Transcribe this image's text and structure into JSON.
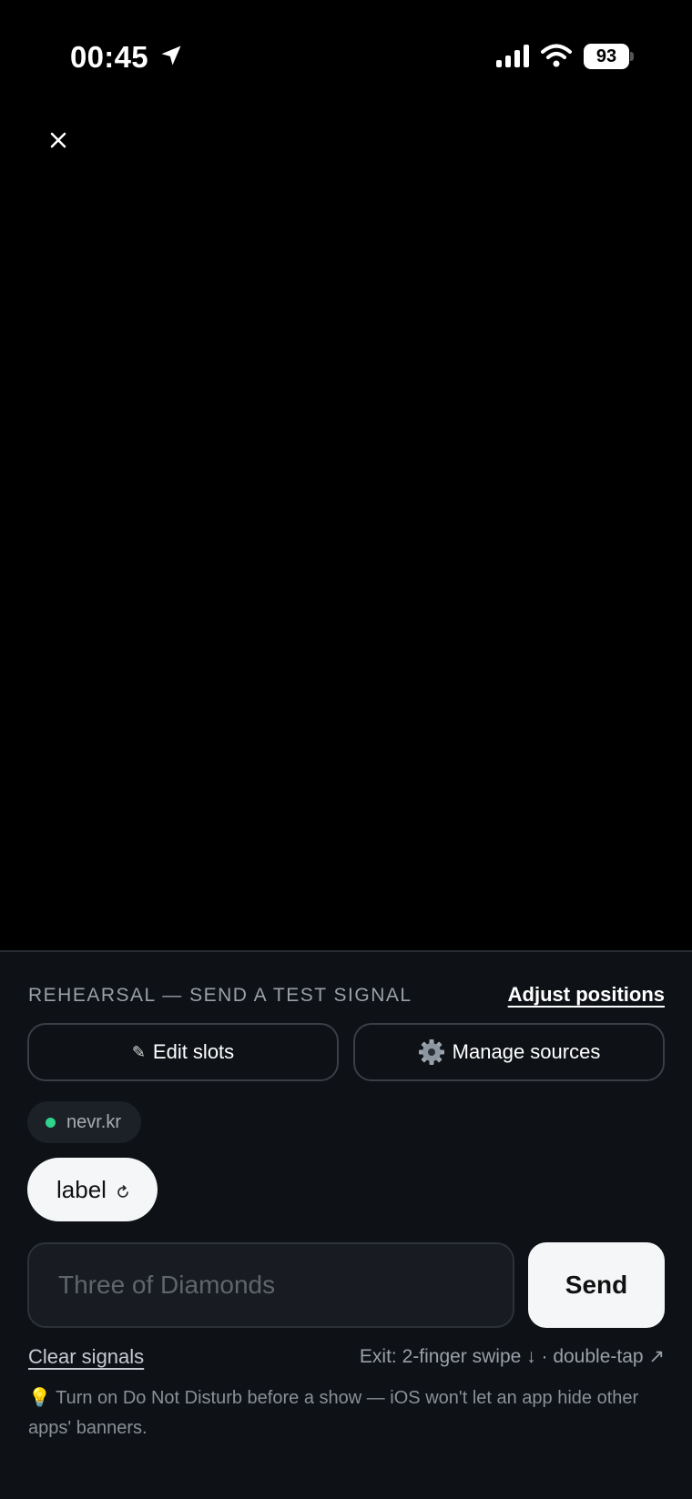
{
  "status_bar": {
    "time": "00:45",
    "battery": "93",
    "icons": [
      "location-arrow-icon",
      "cellular-signal-icon",
      "wifi-icon",
      "battery-icon"
    ]
  },
  "close": {
    "glyph": "×",
    "icon": "close-icon"
  },
  "panel": {
    "heading": "REHEARSAL — SEND A TEST SIGNAL",
    "adjust_label": "Adjust positions",
    "edit_slots": {
      "icon": "✎",
      "label": "Edit slots"
    },
    "manage_sources": {
      "icon": "gear-icon",
      "label": "Manage sources"
    },
    "source_chip": {
      "label": "nevr.kr",
      "status_color": "#2fd38b"
    },
    "label_chip": {
      "label": "label",
      "icon": "refresh-icon"
    },
    "input": {
      "placeholder": "Three of Diamonds",
      "value": ""
    },
    "send_label": "Send",
    "clear_label": "Clear signals",
    "exit_hint": "Exit: 2-finger swipe ↓ · double-tap ↗",
    "tip": "💡 Turn on Do Not Disturb before a show — iOS won't let an app hide other apps' banners."
  }
}
